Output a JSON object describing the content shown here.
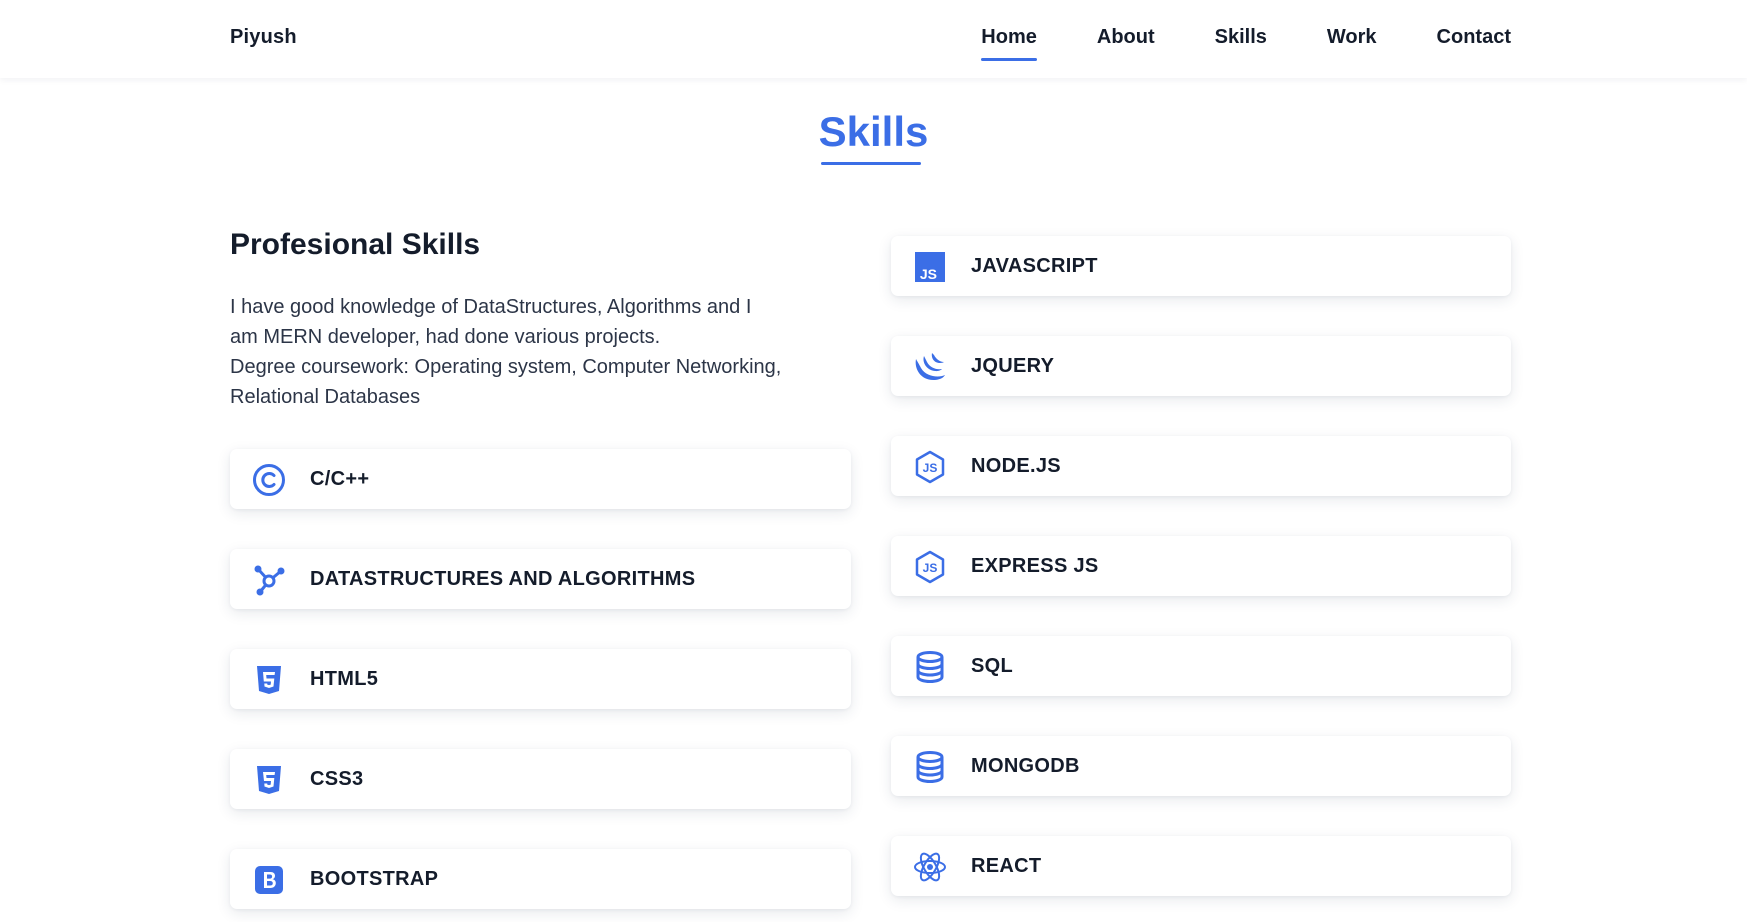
{
  "brand": "Piyush",
  "nav": {
    "items": [
      {
        "label": "Home",
        "active": true
      },
      {
        "label": "About"
      },
      {
        "label": "Skills"
      },
      {
        "label": "Work"
      },
      {
        "label": "Contact"
      }
    ]
  },
  "section": {
    "title": "Skills"
  },
  "professional": {
    "heading": "Profesional Skills",
    "description_lines": [
      "I have good knowledge of DataStructures, Algorithms and I",
      "am MERN developer, had done various projects.",
      "Degree coursework: Operating system, Computer Networking,",
      "Relational Databases"
    ]
  },
  "skills_left": [
    {
      "label": "C/C++",
      "icon": "copyright-icon"
    },
    {
      "label": "DATASTRUCTURES AND ALGORITHMS",
      "icon": "graph-icon"
    },
    {
      "label": "HTML5",
      "icon": "html5-icon"
    },
    {
      "label": "CSS3",
      "icon": "css3-icon"
    },
    {
      "label": "BOOTSTRAP",
      "icon": "bootstrap-icon"
    }
  ],
  "skills_right": [
    {
      "label": "JAVASCRIPT",
      "icon": "javascript-icon"
    },
    {
      "label": "JQUERY",
      "icon": "jquery-icon"
    },
    {
      "label": "NODE.JS",
      "icon": "nodejs-icon"
    },
    {
      "label": "EXPRESS JS",
      "icon": "nodejs-icon"
    },
    {
      "label": "SQL",
      "icon": "database-icon"
    },
    {
      "label": "MONGODB",
      "icon": "database-icon"
    },
    {
      "label": "REACT",
      "icon": "react-icon"
    }
  ],
  "colors": {
    "accent": "#3b6ee6",
    "text": "#141c2b"
  }
}
